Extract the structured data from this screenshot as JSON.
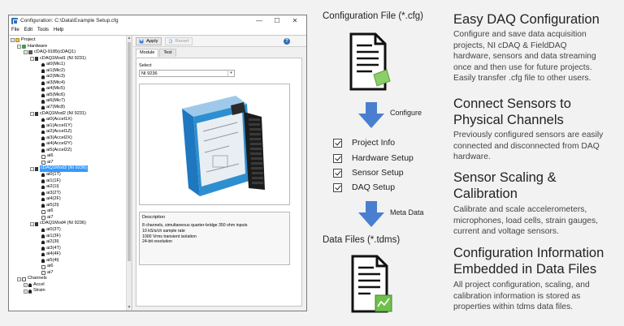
{
  "window": {
    "title": "Configuration: C:\\Data\\Example Setup.cfg",
    "controls": {
      "minimize": "—",
      "maximize": "☐",
      "close": "✕"
    },
    "menu": [
      "File",
      "Edit",
      "Tools",
      "Help"
    ]
  },
  "tree": [
    {
      "label": "Project",
      "expander": "−",
      "icon": "folder-icon"
    },
    {
      "label": "Hardware",
      "expander": "−",
      "icon": "hardware-icon"
    },
    {
      "label": "cDAQ-9185(cDAQ1)",
      "expander": "−",
      "icon": "chassis-icon"
    },
    {
      "label": "cDAQ1Mod1 (NI 9231)",
      "expander": "−",
      "icon": "module-icon"
    },
    {
      "label": "ai0(Mic1)",
      "icon": "sensor-icon"
    },
    {
      "label": "ai1(Mic2)",
      "icon": "sensor-icon"
    },
    {
      "label": "ai2(Mic3)",
      "icon": "sensor-icon"
    },
    {
      "label": "ai3(Mic4)",
      "icon": "sensor-icon"
    },
    {
      "label": "ai4(Mic5)",
      "icon": "sensor-icon"
    },
    {
      "label": "ai5(Mic6)",
      "icon": "sensor-icon"
    },
    {
      "label": "ai6(Mic7)",
      "icon": "sensor-icon"
    },
    {
      "label": "ai7(Mic8)",
      "icon": "sensor-icon"
    },
    {
      "label": "cDAQ1Mod2 (NI 9231)",
      "expander": "−",
      "icon": "module-icon"
    },
    {
      "label": "ai0(Accel1X)",
      "icon": "accel-icon"
    },
    {
      "label": "ai1(Accel1Y)",
      "icon": "accel-icon"
    },
    {
      "label": "ai2(Accel1Z)",
      "icon": "accel-icon"
    },
    {
      "label": "ai3(Accel2X)",
      "icon": "accel-icon"
    },
    {
      "label": "ai4(Accel2Y)",
      "icon": "accel-icon"
    },
    {
      "label": "ai5(Accel2Z)",
      "icon": "accel-icon"
    },
    {
      "label": "ai6",
      "icon": "channel-icon"
    },
    {
      "label": "ai7",
      "icon": "channel-icon"
    },
    {
      "label": "cDAQ1Mod3 (NI 9236)",
      "expander": "−",
      "icon": "module-icon",
      "selected": true
    },
    {
      "label": "ai0(1T)",
      "icon": "strain-icon"
    },
    {
      "label": "ai1(1F)",
      "icon": "strain-icon"
    },
    {
      "label": "ai2(1l)",
      "icon": "strain-icon"
    },
    {
      "label": "ai3(2T)",
      "icon": "strain-icon"
    },
    {
      "label": "ai4(2F)",
      "icon": "strain-icon"
    },
    {
      "label": "ai5(2l)",
      "icon": "strain-icon"
    },
    {
      "label": "ai6",
      "icon": "channel-icon"
    },
    {
      "label": "ai7",
      "icon": "channel-icon"
    },
    {
      "label": "cDAQ1Mod4 (NI 9236)",
      "expander": "−",
      "icon": "module-icon"
    },
    {
      "label": "ai0(3T)",
      "icon": "strain-icon"
    },
    {
      "label": "ai1(3F)",
      "icon": "strain-icon"
    },
    {
      "label": "ai2(3l)",
      "icon": "strain-icon"
    },
    {
      "label": "ai3(4T)",
      "icon": "strain-icon"
    },
    {
      "label": "ai4(4F)",
      "icon": "strain-icon"
    },
    {
      "label": "ai5(4l)",
      "icon": "strain-icon"
    },
    {
      "label": "ai6",
      "icon": "channel-icon"
    },
    {
      "label": "ai7",
      "icon": "channel-icon"
    },
    {
      "label": "Channels",
      "expander": "−",
      "icon": "channels-icon"
    },
    {
      "label": "Accel",
      "expander": "+",
      "icon": "accel-group-icon"
    },
    {
      "label": "Strain",
      "expander": "+",
      "icon": "strain-group-icon"
    }
  ],
  "toolbar": {
    "apply": "Apply",
    "revert": "Revert",
    "help": "?"
  },
  "tabs": [
    "Module",
    "Test"
  ],
  "select": {
    "label": "Select",
    "value": "NI 9236"
  },
  "description": {
    "title": "Description",
    "lines": [
      "8 channels, simultaneous quarter-bridge  350 ohm inputs",
      "10 kS/s/ch sample rate",
      "1000 Vrms transient isolation",
      "24-bit resolution"
    ]
  },
  "workflow": {
    "config_file": "Configuration File (*.cfg)",
    "configure": "Configure",
    "steps": [
      "Project Info",
      "Hardware Setup",
      "Sensor Setup",
      "DAQ Setup"
    ],
    "meta_data": "Meta Data",
    "data_files": "Data Files (*.tdms)"
  },
  "sections": [
    {
      "heading": [
        "Easy DAQ Configuration"
      ],
      "body": [
        "Configure and save data acquisition",
        "projects, NI cDAQ & FieldDAQ",
        "hardware, sensors and data streaming",
        "once and then use for future projects.",
        "Easily transfer .cfg file to other users."
      ]
    },
    {
      "heading": [
        "Connect Sensors to",
        "Physical Channels"
      ],
      "body": [
        "Previously configured sensors are easily",
        "connected and disconnected from DAQ",
        "hardware."
      ]
    },
    {
      "heading": [
        "Sensor Scaling &",
        "Calibration"
      ],
      "body": [
        "Calibrate and scale accelerometers,",
        "microphones, load cells, strain gauges,",
        "current and voltage sensors."
      ]
    },
    {
      "heading": [
        "Configuration Information",
        "Embedded in Data Files"
      ],
      "body": [
        "All project configuration, scaling, and",
        "calibration information is stored as",
        "properties within tdms data files."
      ]
    }
  ],
  "colors": {
    "arrow": "#4a7fd0",
    "selection": "#3399ff",
    "cfg_badge": "#8ccf6a",
    "tdms_badge": "#6fbf4c",
    "module_body": "#2d8fd0",
    "connector": "#1c1c1c"
  }
}
